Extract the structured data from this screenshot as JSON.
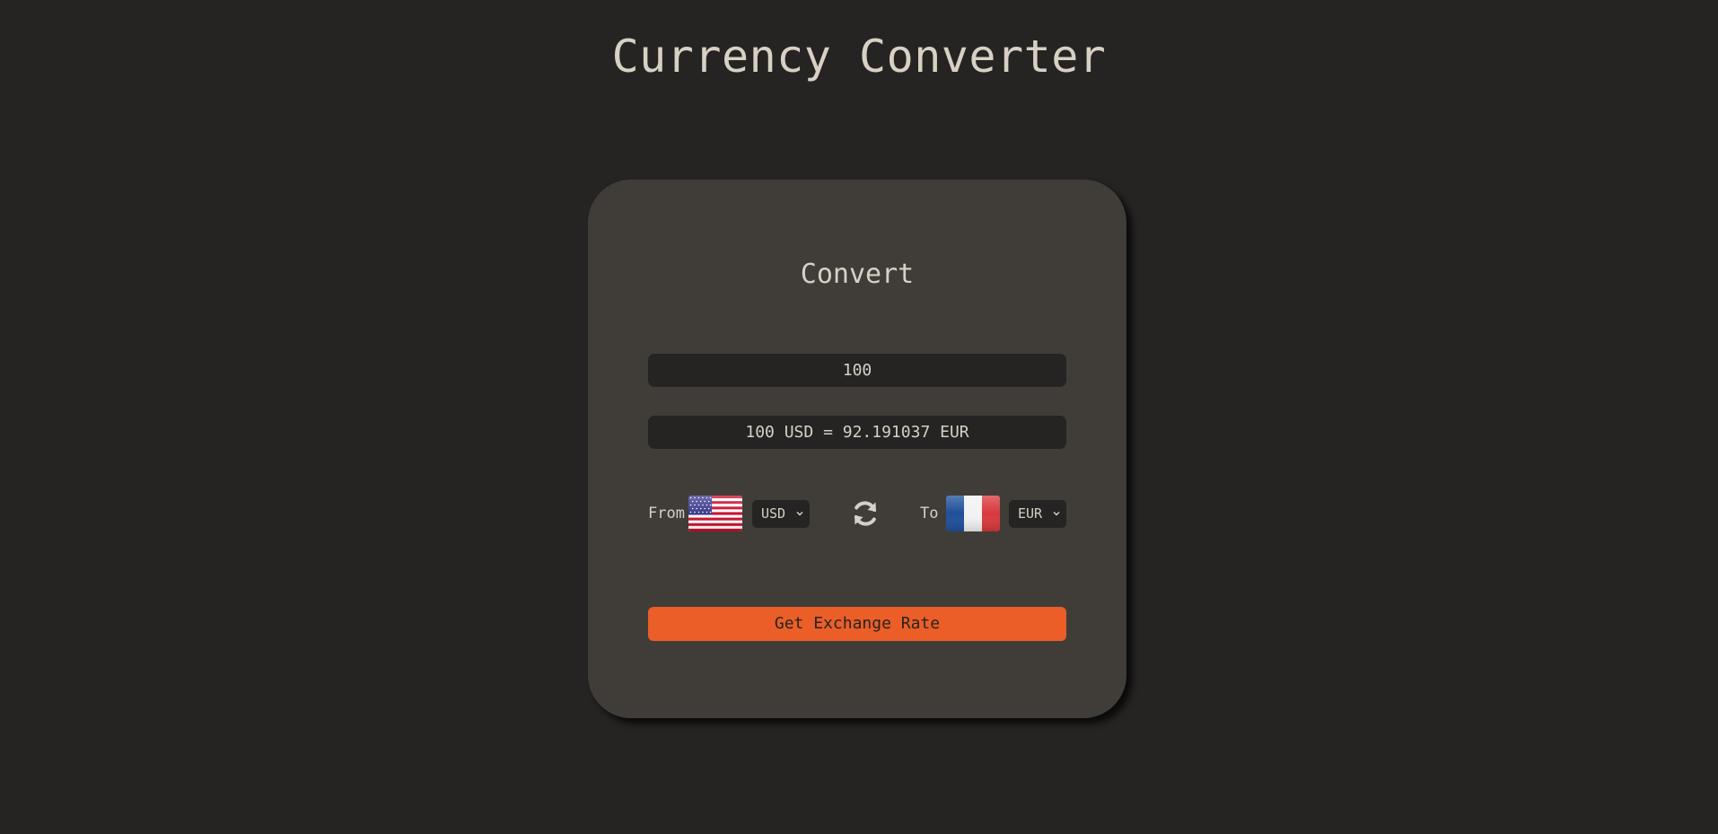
{
  "header": {
    "title": "Currency Converter"
  },
  "converter": {
    "title": "Convert",
    "amount_value": "100",
    "result_text": "100 USD = 92.191037 EUR",
    "from_label": "From",
    "to_label": "To",
    "from_currency": "USD",
    "to_currency": "EUR",
    "button_label": "Get Exchange Rate",
    "swap_icon": "refresh-icon",
    "dropdown_icon": "chevron-down-icon"
  },
  "colors": {
    "background": "#252422",
    "card": "#403d39",
    "accent": "#eb5e28",
    "text": "#d6d0c6"
  }
}
